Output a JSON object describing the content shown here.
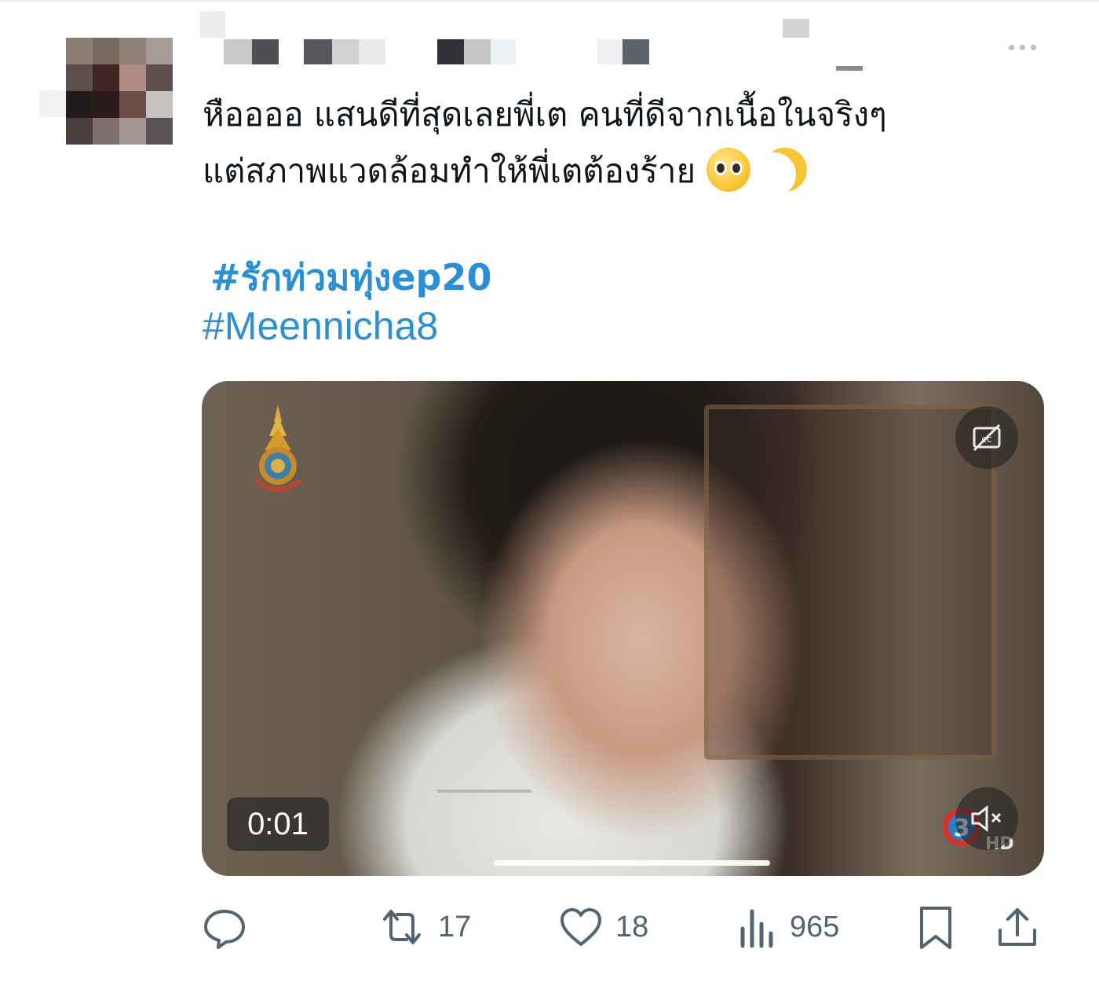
{
  "tweet": {
    "text_lines": [
      "หืออออ แสนดีที่สุดเลยพี่เต คนที่ดีจากเนื้อในจริงๆ",
      "แต่สภาพแวดล้อมทำให้พี่เตต้องร้าย"
    ],
    "emojis": [
      "pleading-face",
      "crescent-moon"
    ],
    "hashtags": [
      "#รักท่วมทุ่งep20",
      "#Meennicha8"
    ]
  },
  "video": {
    "timestamp": "0:01",
    "overlay_icons": [
      "royal-emblem-icon",
      "closed-captions-icon",
      "mute-icon",
      "channel3-hd-logo"
    ],
    "progress": 0.32
  },
  "actions": {
    "reply": {
      "icon": "reply-icon",
      "count": ""
    },
    "retweet": {
      "icon": "retweet-icon",
      "count": "17"
    },
    "like": {
      "icon": "heart-icon",
      "count": "18"
    },
    "views": {
      "icon": "views-icon",
      "count": "965"
    },
    "bookmark": {
      "icon": "bookmark-icon"
    },
    "share": {
      "icon": "share-icon"
    }
  },
  "colors": {
    "hashtag": "#1d9bf0",
    "icon_gray": "#536471",
    "text": "#0f1419"
  }
}
